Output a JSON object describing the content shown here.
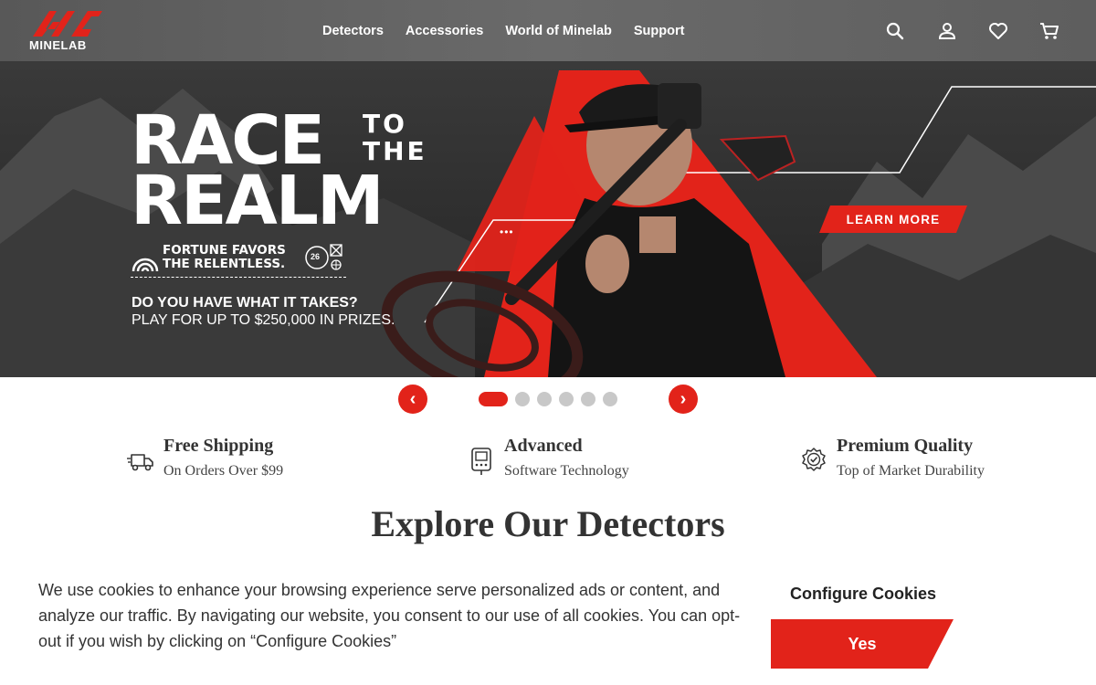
{
  "header": {
    "logo_text": "MINELAB",
    "nav": [
      "Detectors",
      "Accessories",
      "World of Minelab",
      "Support"
    ],
    "icons": [
      "search-icon",
      "account-icon",
      "wishlist-heart-icon",
      "cart-icon"
    ]
  },
  "hero": {
    "headline_race": "RACE",
    "headline_to": "TO",
    "headline_the": "THE",
    "headline_realm": "REALM",
    "tagline_1": "FORTUNE FAVORS",
    "tagline_2": "THE RELENTLESS.",
    "badge_number": "26",
    "promo_line_1": "DO YOU HAVE WHAT IT TAKES?",
    "promo_line_2": "PLAY FOR UP TO $250,000 IN PRIZES.",
    "cta_label": "LEARN MORE",
    "menu_dots": "•••"
  },
  "carousel": {
    "prev_label": "‹",
    "next_label": "›",
    "slide_count": 6,
    "active_index": 0
  },
  "features": [
    {
      "title": "Free Shipping",
      "subtitle": "On Orders Over $99",
      "icon": "truck-icon"
    },
    {
      "title": "Advanced",
      "subtitle": "Software Technology",
      "icon": "detector-screen-icon"
    },
    {
      "title": "Premium Quality",
      "subtitle": "Top of Market Durability",
      "icon": "quality-badge-icon"
    }
  ],
  "section_title": "Explore Our Detectors",
  "cookie": {
    "text": "We use cookies to enhance your browsing experience serve personalized ads or content, and analyze our traffic. By navigating our website, you consent to our use of all cookies. You can opt-out if you wish by clicking on “Configure Cookies”",
    "configure_label": "Configure Cookies",
    "accept_label": "Yes"
  },
  "colors": {
    "brand_red": "#e2231a",
    "header_gray": "#616161",
    "dot_inactive": "#c8c8c8"
  }
}
